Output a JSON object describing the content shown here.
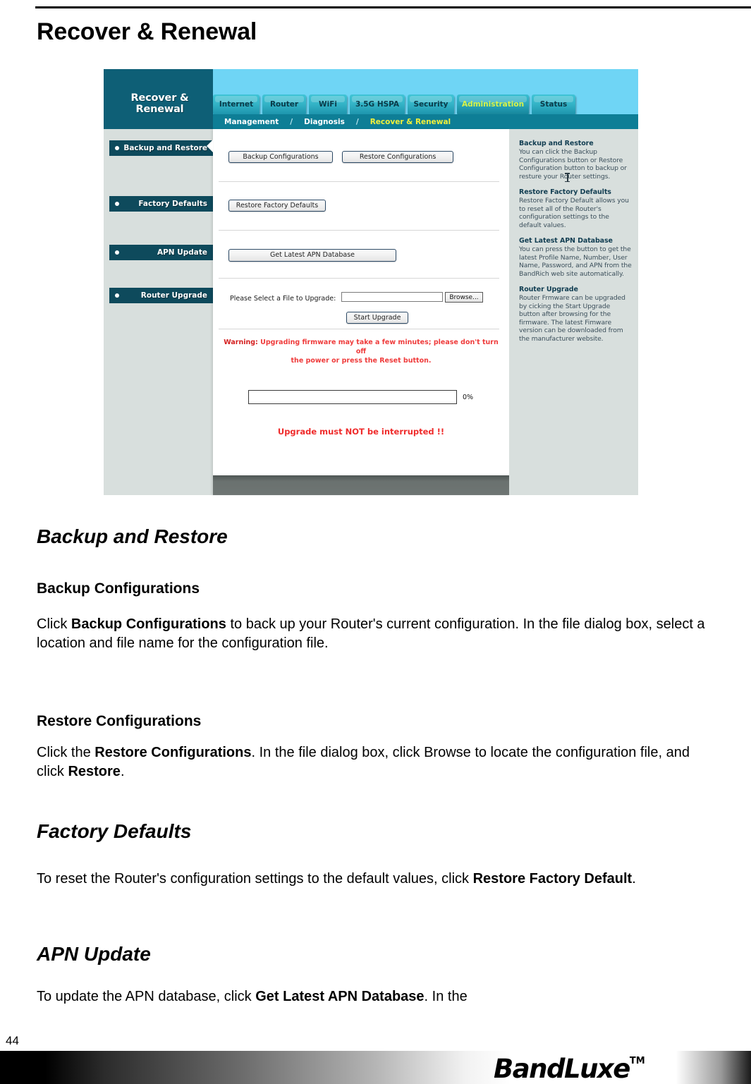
{
  "page": {
    "title": "Recover & Renewal",
    "number": "44",
    "footer_logo": "BandLuxe",
    "footer_logo_tm": "TM"
  },
  "screenshot": {
    "brand_title": "Recover & Renewal",
    "tabs": [
      {
        "label": "Internet",
        "active": false
      },
      {
        "label": "Router",
        "active": false
      },
      {
        "label": "WiFi",
        "active": false
      },
      {
        "label": "3.5G HSPA",
        "active": false
      },
      {
        "label": "Security",
        "active": false
      },
      {
        "label": "Administration",
        "active": true
      },
      {
        "label": "Status",
        "active": false
      }
    ],
    "subnav": {
      "items": [
        "Management",
        "Diagnosis",
        "Recover & Renewal"
      ],
      "separator": "/",
      "current": "Recover & Renewal"
    },
    "sidebar": [
      {
        "label": "Backup and Restore"
      },
      {
        "label": "Factory Defaults"
      },
      {
        "label": "APN Update"
      },
      {
        "label": "Router Upgrade"
      }
    ],
    "main": {
      "backup_button": "Backup Configurations",
      "restore_button": "Restore Configurations",
      "restore_defaults_button": "Restore Factory Defaults",
      "get_apn_button": "Get Latest APN Database",
      "upgrade_file_label": "Please Select a File to Upgrade:",
      "upgrade_file_value": "",
      "browse_button": "Browse...",
      "start_upgrade_button": "Start Upgrade",
      "warning_prefix": "Warning:",
      "warning_line1": "Upgrading firmware may take a few minutes; please don't turn off",
      "warning_line2": "the power or press the Reset button.",
      "progress_percent": "0%",
      "progress_value": 0,
      "interrupt_warning": "Upgrade must NOT be interrupted !!"
    },
    "help": [
      {
        "heading": "Backup and Restore",
        "body": "You can click the Backup Configurations button or Restore Configuration button to backup or resture your Router settings."
      },
      {
        "heading": "Restore Factory Defaults",
        "body": "Restore Factory Default allows you to reset all of the Router's configuration settings to the default values."
      },
      {
        "heading": "Get Latest APN Database",
        "body": "You can press the button to get the latest Profile Name, Number, User Name, Password, and APN from the BandRich web site automatically."
      },
      {
        "heading": "Router Upgrade",
        "body": "Router Frmware can be upgraded by cicking the Start Upgrade button after browsing for the firmware. The latest Fimware version can be downloaded from the manufacturer website."
      }
    ]
  },
  "sections": {
    "backup_and_restore": {
      "heading": "Backup and Restore",
      "sub1_heading": "Backup Configurations",
      "sub1_p_1": "Click ",
      "sub1_p_b1": "Backup Configurations",
      "sub1_p_2": " to back up your Router's current configuration. In the file dialog box, select a location and file name for the configuration file.",
      "sub2_heading": "Restore Configurations",
      "sub2_p_1": "Click the ",
      "sub2_p_b1": "Restore Configurations",
      "sub2_p_2": ". In the file dialog box, click Browse to locate the configuration file, and click ",
      "sub2_p_b2": "Restore",
      "sub2_p_3": "."
    },
    "factory_defaults": {
      "heading": "Factory Defaults",
      "p_1": "To reset the Router's configuration settings to the default values, click ",
      "p_b1": "Restore Factory Default",
      "p_2": "."
    },
    "apn_update": {
      "heading": "APN Update",
      "p_1": "To update the APN database, click ",
      "p_b1": "Get Latest APN Database",
      "p_2": ". In the"
    }
  }
}
